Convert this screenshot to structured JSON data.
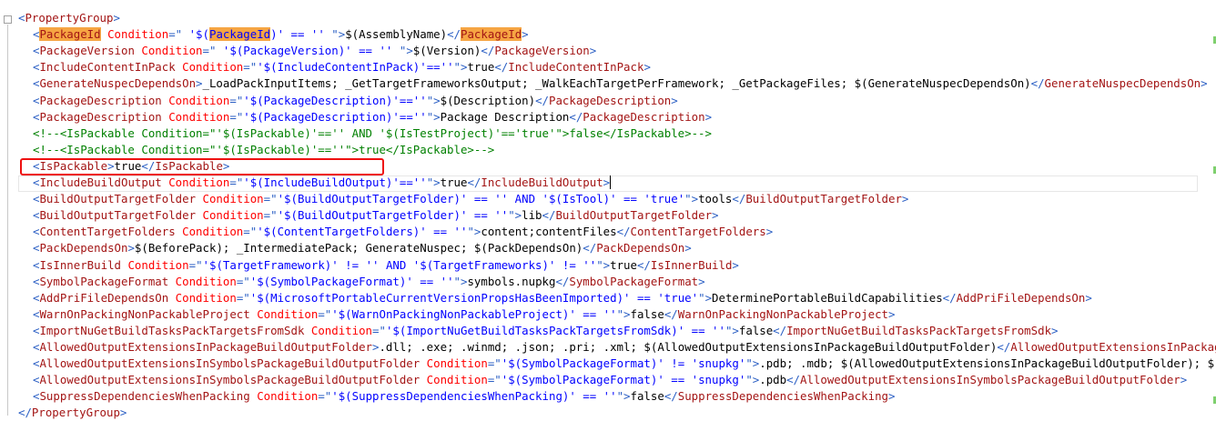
{
  "colors": {
    "bracket": "#2b5fc4",
    "tag": "#a31515",
    "attr": "#ff0000",
    "value": "#0000ff",
    "comment": "#008000",
    "text": "#000000",
    "highlight": "#f6a543",
    "annotation": "#e11111",
    "scroll_marker": "#7fd06e"
  },
  "editor": {
    "lines": [
      {
        "k": "root",
        "t": [
          [
            "b",
            "<"
          ],
          [
            "n",
            "PropertyGroup"
          ],
          [
            "b",
            ">"
          ]
        ]
      },
      {
        "k": "i",
        "t": [
          [
            "b",
            "<"
          ],
          [
            "nh",
            "PackageId"
          ],
          [
            "a",
            " Condition"
          ],
          [
            "b",
            "=\""
          ],
          [
            "v",
            " '$("
          ],
          [
            "vh",
            "PackageId"
          ],
          [
            "v",
            ")' == '' "
          ],
          [
            "b",
            "\">"
          ],
          [
            "x",
            "$(AssemblyName)"
          ],
          [
            "b",
            "</"
          ],
          [
            "nh",
            "PackageId"
          ],
          [
            "b",
            ">"
          ]
        ]
      },
      {
        "k": "i",
        "t": [
          [
            "b",
            "<"
          ],
          [
            "n",
            "PackageVersion"
          ],
          [
            "a",
            " Condition"
          ],
          [
            "b",
            "=\""
          ],
          [
            "v",
            " '$(PackageVersion)' == '' "
          ],
          [
            "b",
            "\">"
          ],
          [
            "x",
            "$(Version)"
          ],
          [
            "b",
            "</"
          ],
          [
            "n",
            "PackageVersion"
          ],
          [
            "b",
            ">"
          ]
        ]
      },
      {
        "k": "i",
        "t": [
          [
            "b",
            "<"
          ],
          [
            "n",
            "IncludeContentInPack"
          ],
          [
            "a",
            " Condition"
          ],
          [
            "b",
            "=\""
          ],
          [
            "v",
            "'$(IncludeContentInPack)'==''"
          ],
          [
            "b",
            "\">"
          ],
          [
            "x",
            "true"
          ],
          [
            "b",
            "</"
          ],
          [
            "n",
            "IncludeContentInPack"
          ],
          [
            "b",
            ">"
          ]
        ]
      },
      {
        "k": "i",
        "t": [
          [
            "b",
            "<"
          ],
          [
            "n",
            "GenerateNuspecDependsOn"
          ],
          [
            "b",
            ">"
          ],
          [
            "x",
            "_LoadPackInputItems; _GetTargetFrameworksOutput; _WalkEachTargetPerFramework; _GetPackageFiles; $(GenerateNuspecDependsOn)"
          ],
          [
            "b",
            "</"
          ],
          [
            "n",
            "GenerateNuspecDependsOn"
          ],
          [
            "b",
            ">"
          ]
        ]
      },
      {
        "k": "i",
        "t": [
          [
            "b",
            "<"
          ],
          [
            "n",
            "PackageDescription"
          ],
          [
            "a",
            " Condition"
          ],
          [
            "b",
            "=\""
          ],
          [
            "v",
            "'$(PackageDescription)'==''"
          ],
          [
            "b",
            "\">"
          ],
          [
            "x",
            "$(Description)"
          ],
          [
            "b",
            "</"
          ],
          [
            "n",
            "PackageDescription"
          ],
          [
            "b",
            ">"
          ]
        ]
      },
      {
        "k": "i",
        "t": [
          [
            "b",
            "<"
          ],
          [
            "n",
            "PackageDescription"
          ],
          [
            "a",
            " Condition"
          ],
          [
            "b",
            "=\""
          ],
          [
            "v",
            "'$(PackageDescription)'==''"
          ],
          [
            "b",
            "\">"
          ],
          [
            "x",
            "Package Description"
          ],
          [
            "b",
            "</"
          ],
          [
            "n",
            "PackageDescription"
          ],
          [
            "b",
            ">"
          ]
        ]
      },
      {
        "k": "i",
        "t": [
          [
            "c",
            "<!--<IsPackable Condition=\"'$(IsPackable)'=='' AND '$(IsTestProject)'=='true'\">false</IsPackable>-->"
          ]
        ]
      },
      {
        "k": "i",
        "t": [
          [
            "c",
            "<!--<IsPackable Condition=\"'$(IsPackable)'==''\">true</IsPackable>-->"
          ]
        ]
      },
      {
        "k": "i",
        "t": [
          [
            "b",
            "<"
          ],
          [
            "n",
            "IsPackable"
          ],
          [
            "b",
            ">"
          ],
          [
            "x",
            "true"
          ],
          [
            "b",
            "</"
          ],
          [
            "n",
            "IsPackable"
          ],
          [
            "b",
            ">"
          ]
        ]
      },
      {
        "k": "i",
        "caret": true,
        "t": [
          [
            "b",
            "<"
          ],
          [
            "n",
            "IncludeBuildOutput"
          ],
          [
            "a",
            " Condition"
          ],
          [
            "b",
            "=\""
          ],
          [
            "v",
            "'$(IncludeBuildOutput)'==''"
          ],
          [
            "b",
            "\">"
          ],
          [
            "x",
            "true"
          ],
          [
            "b",
            "</"
          ],
          [
            "n",
            "IncludeBuildOutput"
          ],
          [
            "b",
            ">"
          ]
        ]
      },
      {
        "k": "i",
        "t": [
          [
            "b",
            "<"
          ],
          [
            "n",
            "BuildOutputTargetFolder"
          ],
          [
            "a",
            " Condition"
          ],
          [
            "b",
            "=\""
          ],
          [
            "v",
            "'$(BuildOutputTargetFolder)' == '' AND '$(IsTool)' == 'true'"
          ],
          [
            "b",
            "\">"
          ],
          [
            "x",
            "tools"
          ],
          [
            "b",
            "</"
          ],
          [
            "n",
            "BuildOutputTargetFolder"
          ],
          [
            "b",
            ">"
          ]
        ]
      },
      {
        "k": "i",
        "t": [
          [
            "b",
            "<"
          ],
          [
            "n",
            "BuildOutputTargetFolder"
          ],
          [
            "a",
            " Condition"
          ],
          [
            "b",
            "=\""
          ],
          [
            "v",
            "'$(BuildOutputTargetFolder)' == ''"
          ],
          [
            "b",
            "\">"
          ],
          [
            "x",
            "lib"
          ],
          [
            "b",
            "</"
          ],
          [
            "n",
            "BuildOutputTargetFolder"
          ],
          [
            "b",
            ">"
          ]
        ]
      },
      {
        "k": "i",
        "t": [
          [
            "b",
            "<"
          ],
          [
            "n",
            "ContentTargetFolders"
          ],
          [
            "a",
            " Condition"
          ],
          [
            "b",
            "=\""
          ],
          [
            "v",
            "'$(ContentTargetFolders)' == ''"
          ],
          [
            "b",
            "\">"
          ],
          [
            "x",
            "content;contentFiles"
          ],
          [
            "b",
            "</"
          ],
          [
            "n",
            "ContentTargetFolders"
          ],
          [
            "b",
            ">"
          ]
        ]
      },
      {
        "k": "i",
        "t": [
          [
            "b",
            "<"
          ],
          [
            "n",
            "PackDependsOn"
          ],
          [
            "b",
            ">"
          ],
          [
            "x",
            "$(BeforePack); _IntermediatePack; GenerateNuspec; $(PackDependsOn)"
          ],
          [
            "b",
            "</"
          ],
          [
            "n",
            "PackDependsOn"
          ],
          [
            "b",
            ">"
          ]
        ]
      },
      {
        "k": "i",
        "t": [
          [
            "b",
            "<"
          ],
          [
            "n",
            "IsInnerBuild"
          ],
          [
            "a",
            " Condition"
          ],
          [
            "b",
            "=\""
          ],
          [
            "v",
            "'$(TargetFramework)' != '' AND '$(TargetFrameworks)' != ''"
          ],
          [
            "b",
            "\">"
          ],
          [
            "x",
            "true"
          ],
          [
            "b",
            "</"
          ],
          [
            "n",
            "IsInnerBuild"
          ],
          [
            "b",
            ">"
          ]
        ]
      },
      {
        "k": "i",
        "t": [
          [
            "b",
            "<"
          ],
          [
            "n",
            "SymbolPackageFormat"
          ],
          [
            "a",
            " Condition"
          ],
          [
            "b",
            "=\""
          ],
          [
            "v",
            "'$(SymbolPackageFormat)' == ''"
          ],
          [
            "b",
            "\">"
          ],
          [
            "x",
            "symbols.nupkg"
          ],
          [
            "b",
            "</"
          ],
          [
            "n",
            "SymbolPackageFormat"
          ],
          [
            "b",
            ">"
          ]
        ]
      },
      {
        "k": "i",
        "t": [
          [
            "b",
            "<"
          ],
          [
            "n",
            "AddPriFileDependsOn"
          ],
          [
            "a",
            " Condition"
          ],
          [
            "b",
            "=\""
          ],
          [
            "v",
            "'$(MicrosoftPortableCurrentVersionPropsHasBeenImported)' == 'true'"
          ],
          [
            "b",
            "\">"
          ],
          [
            "x",
            "DeterminePortableBuildCapabilities"
          ],
          [
            "b",
            "</"
          ],
          [
            "n",
            "AddPriFileDependsOn"
          ],
          [
            "b",
            ">"
          ]
        ]
      },
      {
        "k": "i",
        "t": [
          [
            "b",
            "<"
          ],
          [
            "n",
            "WarnOnPackingNonPackableProject"
          ],
          [
            "a",
            " Condition"
          ],
          [
            "b",
            "=\""
          ],
          [
            "v",
            "'$(WarnOnPackingNonPackableProject)' == ''"
          ],
          [
            "b",
            "\">"
          ],
          [
            "x",
            "false"
          ],
          [
            "b",
            "</"
          ],
          [
            "n",
            "WarnOnPackingNonPackableProject"
          ],
          [
            "b",
            ">"
          ]
        ]
      },
      {
        "k": "i",
        "t": [
          [
            "b",
            "<"
          ],
          [
            "n",
            "ImportNuGetBuildTasksPackTargetsFromSdk"
          ],
          [
            "a",
            " Condition"
          ],
          [
            "b",
            "=\""
          ],
          [
            "v",
            "'$(ImportNuGetBuildTasksPackTargetsFromSdk)' == ''"
          ],
          [
            "b",
            "\">"
          ],
          [
            "x",
            "false"
          ],
          [
            "b",
            "</"
          ],
          [
            "n",
            "ImportNuGetBuildTasksPackTargetsFromSdk"
          ],
          [
            "b",
            ">"
          ]
        ]
      },
      {
        "k": "i",
        "t": [
          [
            "b",
            "<"
          ],
          [
            "n",
            "AllowedOutputExtensionsInPackageBuildOutputFolder"
          ],
          [
            "b",
            ">"
          ],
          [
            "x",
            ".dll; .exe; .winmd; .json; .pri; .xml; $(AllowedOutputExtensionsInPackageBuildOutputFolder)"
          ],
          [
            "b",
            "</"
          ],
          [
            "n",
            "AllowedOutputExtensionsInPackageB"
          ]
        ]
      },
      {
        "k": "i",
        "t": [
          [
            "b",
            "<"
          ],
          [
            "n",
            "AllowedOutputExtensionsInSymbolsPackageBuildOutputFolder"
          ],
          [
            "a",
            " Condition"
          ],
          [
            "b",
            "=\""
          ],
          [
            "v",
            "'$(SymbolPackageFormat)' != 'snupkg'"
          ],
          [
            "b",
            "\">"
          ],
          [
            "x",
            ".pdb; .mdb; $(AllowedOutputExtensionsInPackageBuildOutputFolder); $(Al"
          ]
        ]
      },
      {
        "k": "i",
        "t": [
          [
            "b",
            "<"
          ],
          [
            "n",
            "AllowedOutputExtensionsInSymbolsPackageBuildOutputFolder"
          ],
          [
            "a",
            " Condition"
          ],
          [
            "b",
            "=\""
          ],
          [
            "v",
            "'$(SymbolPackageFormat)' == 'snupkg'"
          ],
          [
            "b",
            "\">"
          ],
          [
            "x",
            ".pdb"
          ],
          [
            "b",
            "</"
          ],
          [
            "n",
            "AllowedOutputExtensionsInSymbolsPackageBuildOutputFolder"
          ],
          [
            "b",
            ">"
          ]
        ]
      },
      {
        "k": "i",
        "t": [
          [
            "b",
            "<"
          ],
          [
            "n",
            "SuppressDependenciesWhenPacking"
          ],
          [
            "a",
            " Condition"
          ],
          [
            "b",
            "=\""
          ],
          [
            "v",
            "'$(SuppressDependenciesWhenPacking)' == ''"
          ],
          [
            "b",
            "\">"
          ],
          [
            "x",
            "false"
          ],
          [
            "b",
            "</"
          ],
          [
            "n",
            "SuppressDependenciesWhenPacking"
          ],
          [
            "b",
            ">"
          ]
        ]
      },
      {
        "k": "root",
        "t": [
          [
            "b",
            "</"
          ],
          [
            "n",
            "PropertyGroup"
          ],
          [
            "b",
            ">"
          ]
        ]
      }
    ]
  }
}
